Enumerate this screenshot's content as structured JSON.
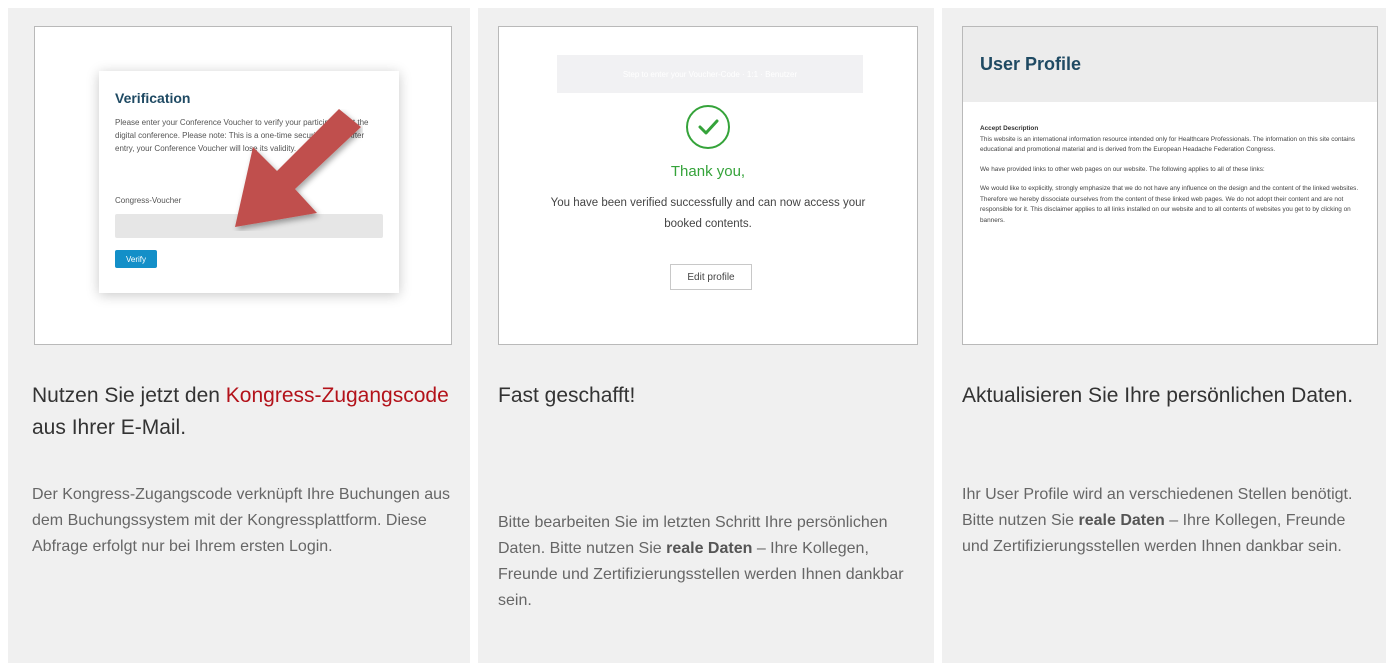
{
  "colors": {
    "accent_red": "#b3121a",
    "verify_blue": "#138fc8",
    "success_green": "#35a33a",
    "title_navy": "#1f4a63"
  },
  "verification": {
    "title": "Verification",
    "text": "Please enter your Conference Voucher to verify your participation at the digital conference. Please note: This is a one-time security query. After entry, your Conference Voucher will lose its validity.",
    "field_label": "Congress-Voucher",
    "button_label": "Verify"
  },
  "thankyou": {
    "ghost_text": "Step to enter your Voucher-Code · 1:1 · Benutzer",
    "title": "Thank you,",
    "text": "You have been verified successfully and can now access your booked contents.",
    "button_label": "Edit profile"
  },
  "profile": {
    "title": "User Profile",
    "accept_heading": "Accept Description",
    "p1": "This website is an international information resource intended only for Healthcare Professionals. The information on this site contains educational and promotional material and is derived from the European  Headache Federation Congress.",
    "p2": "We have provided links to other web pages on our website. The following applies to all of these links:",
    "p3": "We would like to explicitly, strongly emphasize that we do not have any influence on the design and the content of the linked websites. Therefore we hereby dissociate ourselves from the content of these linked web pages. We do not adopt their content and are not responsible for it. This disclaimer applies to all links installed on our website and to all contents of websites you get to by clicking on banners."
  },
  "col1": {
    "heading_before": "Nutzen Sie jetzt den ",
    "heading_red": "Kongress-Zugangscode",
    "heading_after": " aus Ihrer E-Mail.",
    "desc": "Der Kongress-Zugangscode verknüpft Ihre Buchungen aus dem Buchungssystem mit der Kongressplattform. Diese Abfrage erfolgt nur bei Ihrem ersten Login."
  },
  "col2": {
    "heading": "Fast geschafft!",
    "desc_before": "Bitte bearbeiten Sie im letzten Schritt Ihre persönlichen Daten. Bitte nutzen Sie ",
    "desc_bold": "reale Daten",
    "desc_after": " – Ihre Kollegen, Freunde und Zertifizierungsstellen werden Ihnen dankbar sein."
  },
  "col3": {
    "heading": "Aktualisieren Sie Ihre persönlichen Daten.",
    "desc_before": "Ihr User Profile wird an verschiedenen Stellen benötigt. Bitte nutzen Sie ",
    "desc_bold": "reale Daten",
    "desc_after": " – Ihre Kollegen, Freunde und Zertifizierungsstellen werden Ihnen dankbar sein."
  },
  "icons": {
    "arrow": "red-pointer-arrow-icon",
    "check": "check-circle-icon"
  }
}
